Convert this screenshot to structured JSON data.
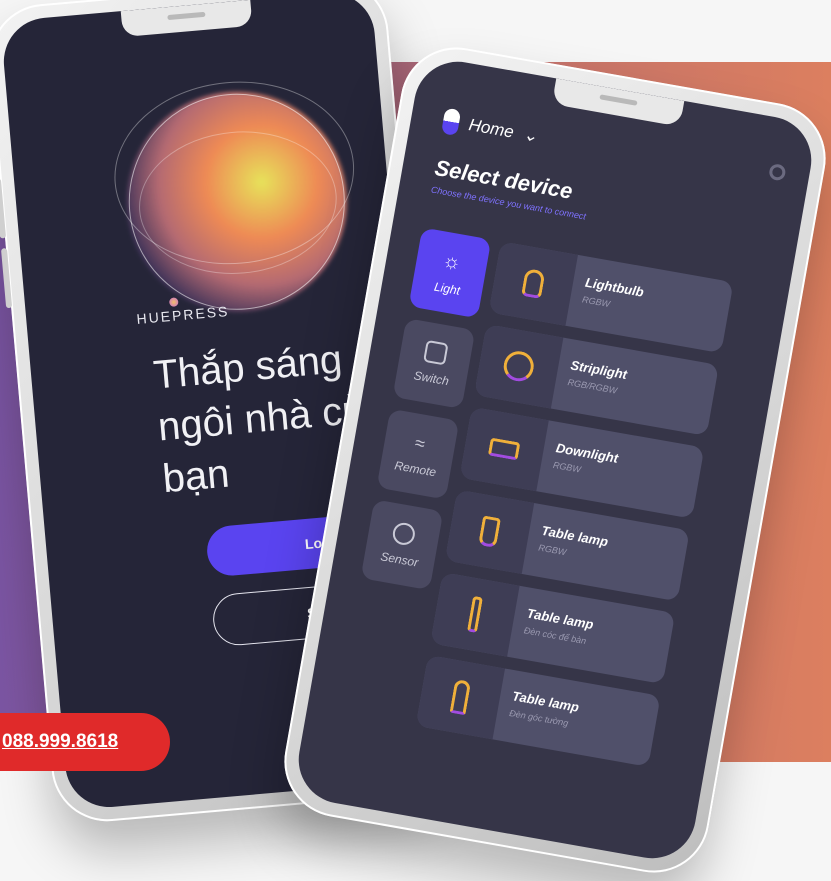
{
  "login_screen": {
    "brand": "HUEPRESS",
    "headline": "Thắp sáng ngôi nhà của bạn",
    "login_label": "Log in",
    "signup_label": "Sign up"
  },
  "device_screen": {
    "location": "Home",
    "title": "Select device",
    "subtitle": "Choose the device you want to connect",
    "categories": [
      {
        "label": "Light",
        "active": true
      },
      {
        "label": "Switch",
        "active": false
      },
      {
        "label": "Remote",
        "active": false
      },
      {
        "label": "Sensor",
        "active": false
      }
    ],
    "devices": [
      {
        "name": "Lightbulb",
        "sub": "RGBW"
      },
      {
        "name": "Striplight",
        "sub": "RGB/RGBW"
      },
      {
        "name": "Downlight",
        "sub": "RGBW"
      },
      {
        "name": "Table lamp",
        "sub": "RGBW"
      },
      {
        "name": "Table lamp",
        "sub": "Đèn cóc để bàn"
      },
      {
        "name": "Table lamp",
        "sub": "Đèn góc tường"
      }
    ]
  },
  "hotline": "088.999.8618",
  "colors": {
    "accent": "#5a44f0",
    "hotline": "#e02a2a",
    "screen_dark": "#252538"
  }
}
